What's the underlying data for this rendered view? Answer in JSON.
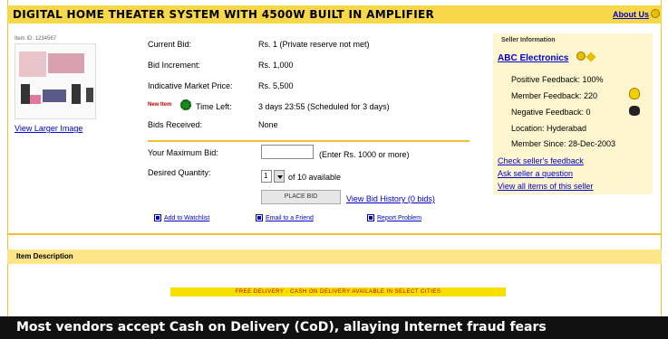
{
  "header": {
    "title": "DIGITAL HOME THEATER SYSTEM WITH 4500W BUILT IN AMPLIFIER",
    "about_link": "About Us"
  },
  "item": {
    "thumb_caption": "Item ID: 1234567",
    "view_images": "View Larger Image",
    "details": [
      {
        "label": "Current Bid:",
        "value": "Rs. 1 (Private reserve not met)"
      },
      {
        "label": "Bid Increment:",
        "value": "Rs. 1,000"
      },
      {
        "label": "Indicative Market Price:",
        "value": "Rs. 5,500"
      },
      {
        "label": "Time Left:",
        "value": "3 days 23:55 (Scheduled for 3 days)"
      },
      {
        "label": "Bids Received:",
        "value": "None"
      }
    ],
    "new_flag": "New Item"
  },
  "bid_form": {
    "bid_label": "Your Maximum Bid:",
    "bid_hint": "(Enter Rs. 1000 or more)",
    "qty_label": "Desired Quantity:",
    "qty_value": "1",
    "qty_hint": "of 10 available",
    "submit_label": "PLACE BID",
    "view_bid_link": "View Bid History (0 bids)"
  },
  "action_links": [
    {
      "label": "Add to Watchlist"
    },
    {
      "label": "Email to a Friend"
    },
    {
      "label": "Report Problem"
    }
  ],
  "seller": {
    "heading": "Seller Information",
    "name": "ABC Electronics",
    "rows": [
      {
        "label": "Positive Feedback: 100%"
      },
      {
        "label": "Member Feedback: 220"
      },
      {
        "label": "Negative Feedback: 0"
      },
      {
        "label": "Location: Hyderabad"
      },
      {
        "label": "Member Since: 28-Dec-2003"
      }
    ],
    "links": [
      "Check seller's feedback",
      "Ask seller a question",
      "View all items of this seller"
    ]
  },
  "description": {
    "title": "Item Description",
    "promo": "FREE DELIVERY · CASH ON DELIVERY AVAILABLE IN SELECT CITIES"
  },
  "caption": "Most vendors accept Cash on Delivery (CoD), allaying Internet fraud fears",
  "colors": {
    "accent": "#f7d84a",
    "link": "#0000cc",
    "seller_bg": "#fff6cf"
  }
}
